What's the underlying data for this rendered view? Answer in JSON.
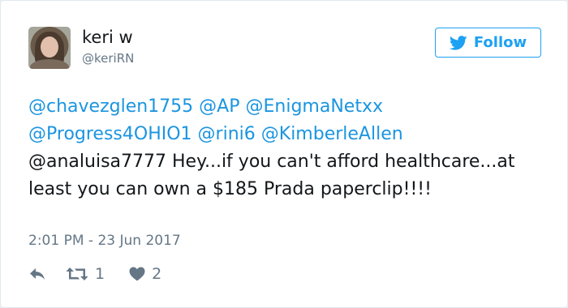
{
  "user": {
    "name": "keri w",
    "handle": "@keriRN"
  },
  "follow_button": {
    "label": "Follow",
    "icon": "twitter-bird-icon",
    "color": "#1da1f2"
  },
  "tweet": {
    "mentions": [
      "@chavezglen1755",
      "@AP",
      "@EnigmaNetxx",
      "@Progress4OHIO1",
      "@rini6",
      "@KimberleAllen",
      "@analuisa7777"
    ],
    "body": " Hey...if you can't afford healthcare...at least you can own a $185 Prada paperclip!!!!",
    "mention_color": "#1b95e0"
  },
  "timestamp": "2:01 PM - 23 Jun 2017",
  "actions": {
    "reply_icon": "reply-icon",
    "retweet_icon": "retweet-icon",
    "retweet_count": "1",
    "like_icon": "heart-icon",
    "like_count": "2"
  }
}
